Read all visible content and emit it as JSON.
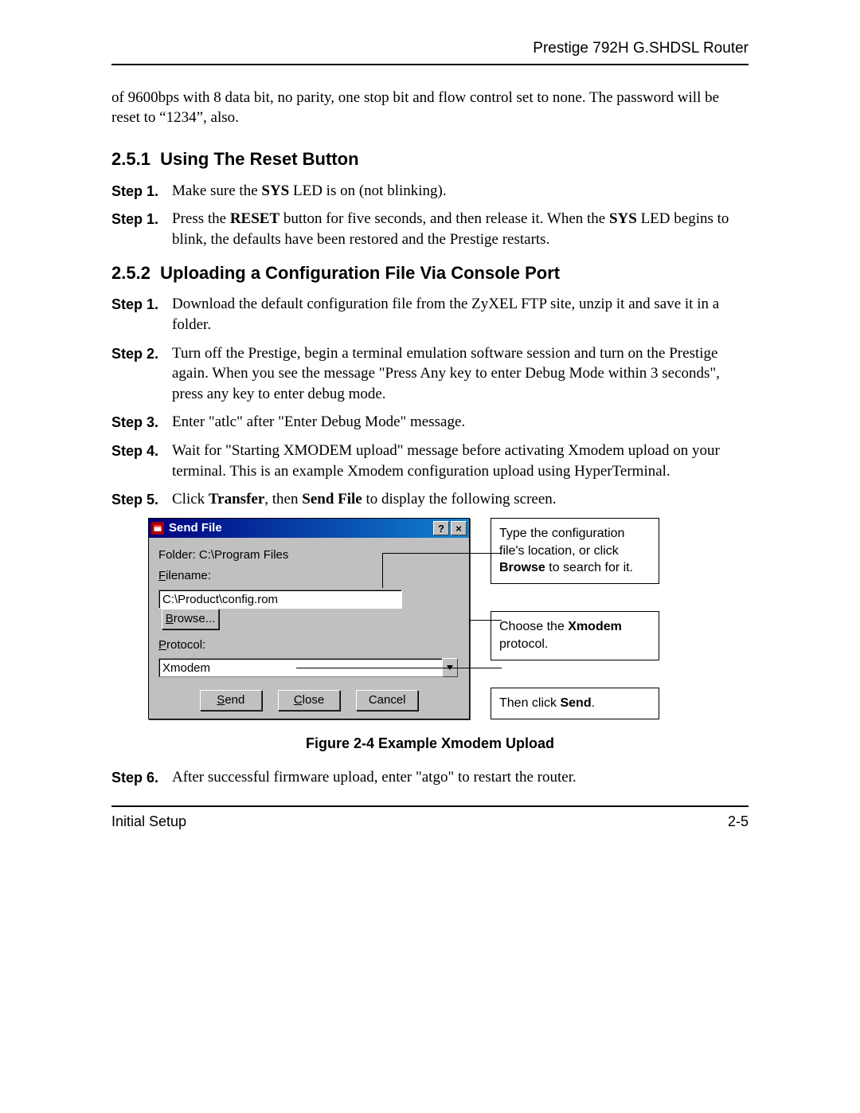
{
  "header": {
    "product": "Prestige 792H G.SHDSL Router"
  },
  "intro": {
    "prefix": "of 9600bps with 8 data bit, no parity, one stop bit and flow control set to none. The password will be reset to “",
    "pw": "1234",
    "suffix": "”, also."
  },
  "sec1": {
    "num": "2.5.1",
    "title": "Using The Reset Button",
    "steps": [
      {
        "label": "Step 1.",
        "pre": "Make sure the ",
        "bold": "SYS",
        "post": " LED is on (not blinking)."
      },
      {
        "label": "Step 1.",
        "pre": "Press the ",
        "bold": "RESET",
        "mid": " button for five seconds, and then release it. When the ",
        "bold2": "SYS",
        "post": " LED begins to blink, the defaults have been restored and the Prestige restarts."
      }
    ]
  },
  "sec2": {
    "num": "2.5.2",
    "title": "Uploading a Configuration File Via Console Port",
    "steps": [
      {
        "label": "Step 1.",
        "text": "Download the default configuration file from the ZyXEL FTP site, unzip it and save it in a folder."
      },
      {
        "label": "Step 2.",
        "text": "Turn off the Prestige, begin a terminal emulation software session and turn on the Prestige again. When you see the message \"Press Any key to enter Debug Mode within 3 seconds\", press any key to enter debug mode."
      },
      {
        "label": "Step 3.",
        "text": "Enter \"atlc\" after \"Enter Debug Mode\" message."
      },
      {
        "label": "Step 4.",
        "text": "Wait for \"Starting XMODEM upload\" message before activating Xmodem upload on your terminal. This is an example Xmodem configuration upload using HyperTerminal."
      },
      {
        "label": "Step 5.",
        "pre": "Click ",
        "b1": "Transfer",
        "mid": ", then ",
        "b2": "Send File",
        "post": " to display the following screen."
      },
      {
        "label": "Step 6.",
        "text": "After successful firmware upload, enter \"atgo\" to restart the router."
      }
    ]
  },
  "dialog": {
    "title": "Send File",
    "folder_label": "Folder:  C:\\Program Files",
    "filename_label_u": "F",
    "filename_label_rest": "ilename:",
    "filename_value": "C:\\Product\\config.rom",
    "browse_u": "B",
    "browse_rest": "rowse...",
    "protocol_label_u": "P",
    "protocol_label_rest": "rotocol:",
    "protocol_value": "Xmodem",
    "send_u": "S",
    "send_rest": "end",
    "close_u": "C",
    "close_rest": "lose",
    "cancel_text": "Cancel"
  },
  "annotations": {
    "a1_pre": "Type the configuration file's location, or click ",
    "a1_bold": "Browse",
    "a1_post": " to search for it.",
    "a2_pre": "Choose the ",
    "a2_bold": "Xmodem",
    "a2_post": " protocol.",
    "a3_pre": "Then click ",
    "a3_bold": "Send",
    "a3_post": "."
  },
  "figure_caption": "Figure 2-4 Example Xmodem Upload",
  "footer": {
    "left": "Initial Setup",
    "right": "2-5"
  }
}
